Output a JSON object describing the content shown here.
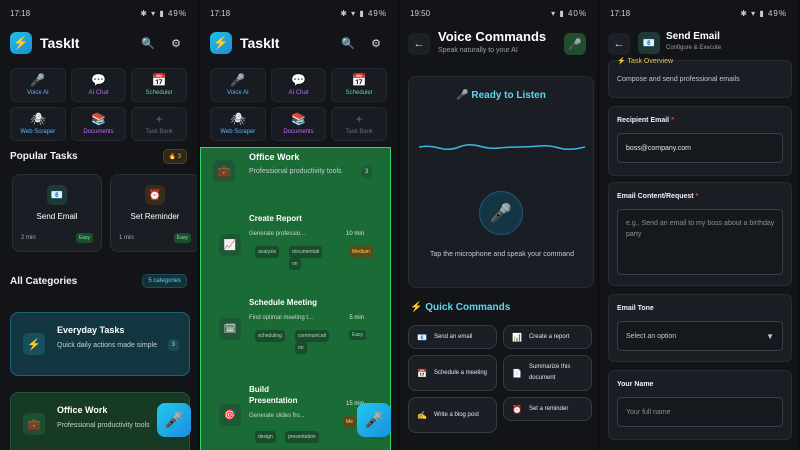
{
  "status": {
    "screen1": {
      "time": "17:18",
      "battery": "49%"
    },
    "screen2": {
      "time": "17:18",
      "battery": "49%"
    },
    "screen3": {
      "time": "19:50",
      "battery": "40%"
    },
    "screen4": {
      "time": "17:18",
      "battery": "49%"
    }
  },
  "app": {
    "title": "TaskIt"
  },
  "features": [
    {
      "label": "Voice AI",
      "icon": "microphone-icon",
      "glyph": "🎤",
      "color": "#5fb8ff"
    },
    {
      "label": "AI Chat",
      "icon": "chat-icon",
      "glyph": "💬",
      "color": "#c765ff"
    },
    {
      "label": "Scheduler",
      "icon": "calendar-icon",
      "glyph": "📅",
      "color": "#58e08a"
    },
    {
      "label": "Web Scraper",
      "icon": "spider-icon",
      "glyph": "🕷",
      "color": "#5fb8ff"
    },
    {
      "label": "Documents",
      "icon": "books-icon",
      "glyph": "📚",
      "color": "#c765ff"
    },
    {
      "label": "Task Bank",
      "icon": "plus-icon",
      "glyph": "+",
      "color": "#666b73"
    }
  ],
  "popular": {
    "title": "Popular Tasks",
    "badge": "🔥 3",
    "tasks": [
      {
        "name": "Send Email",
        "time": "2 min",
        "difficulty": "Easy",
        "glyph": "📧"
      },
      {
        "name": "Set Reminder",
        "time": "1 min",
        "difficulty": "Easy",
        "glyph": "⏰"
      }
    ]
  },
  "categories": {
    "title": "All Categories",
    "badge": "5 categories",
    "items": [
      {
        "title": "Everyday Tasks",
        "desc": "Quick daily actions made simple",
        "count": "3",
        "glyph": "⚡"
      },
      {
        "title": "Office Work",
        "desc": "Professional productivity tools",
        "count": "3",
        "glyph": "💼"
      }
    ]
  },
  "office": {
    "title": "Office Work",
    "desc": "Professional productivity tools",
    "count": "3",
    "glyph": "💼",
    "templates": [
      {
        "name": "Create Report",
        "desc": "Generate professio...",
        "time": "10 min",
        "difficulty": "Medium",
        "tags": [
          "analysis",
          "documentati",
          "on"
        ],
        "glyph": "📈"
      },
      {
        "name": "Schedule Meeting",
        "desc": "Find optimal meeting t...",
        "time": "5 min",
        "difficulty": "Easy",
        "tags": [
          "scheduling",
          "communicati",
          "on"
        ],
        "glyph": "🗓"
      },
      {
        "name": "Build Presentation",
        "desc": "Generate slides fro...",
        "time": "15 min",
        "difficulty": "Me",
        "tags": [
          "design",
          "presentation"
        ],
        "glyph": "🎯"
      }
    ]
  },
  "voice": {
    "title": "Voice Commands",
    "subtitle": "Speak naturally to your AI",
    "ready": "🎤 Ready to Listen",
    "hint": "Tap the microphone and speak your command",
    "quick_title": "⚡ Quick Commands",
    "commands": [
      {
        "label": "Send an email",
        "glyph": "📧"
      },
      {
        "label": "Create a report",
        "glyph": "📊"
      },
      {
        "label": "Schedule a meeting",
        "glyph": "📅"
      },
      {
        "label": "Summarize this document",
        "glyph": "📄"
      },
      {
        "label": "Write a blog post",
        "glyph": "✍"
      },
      {
        "label": "Set a reminder",
        "glyph": "⏰"
      }
    ]
  },
  "email": {
    "title": "Send Email",
    "subtitle": "Configure & Execute",
    "overview_title": "Task Overview",
    "overview_desc": "Compose and send professional emails",
    "recipient_label": "Recipient Email",
    "recipient_value": "boss@company.com",
    "content_label": "Email Content/Request",
    "content_placeholder": "e.g., Send an email to my boss about a birthday party",
    "tone_label": "Email Tone",
    "tone_value": "Select an option",
    "name_label": "Your Name",
    "name_placeholder": "Your full name"
  },
  "colors": {
    "accent": "#20c9e9",
    "green": "#34d36a",
    "bg": "#121418"
  }
}
